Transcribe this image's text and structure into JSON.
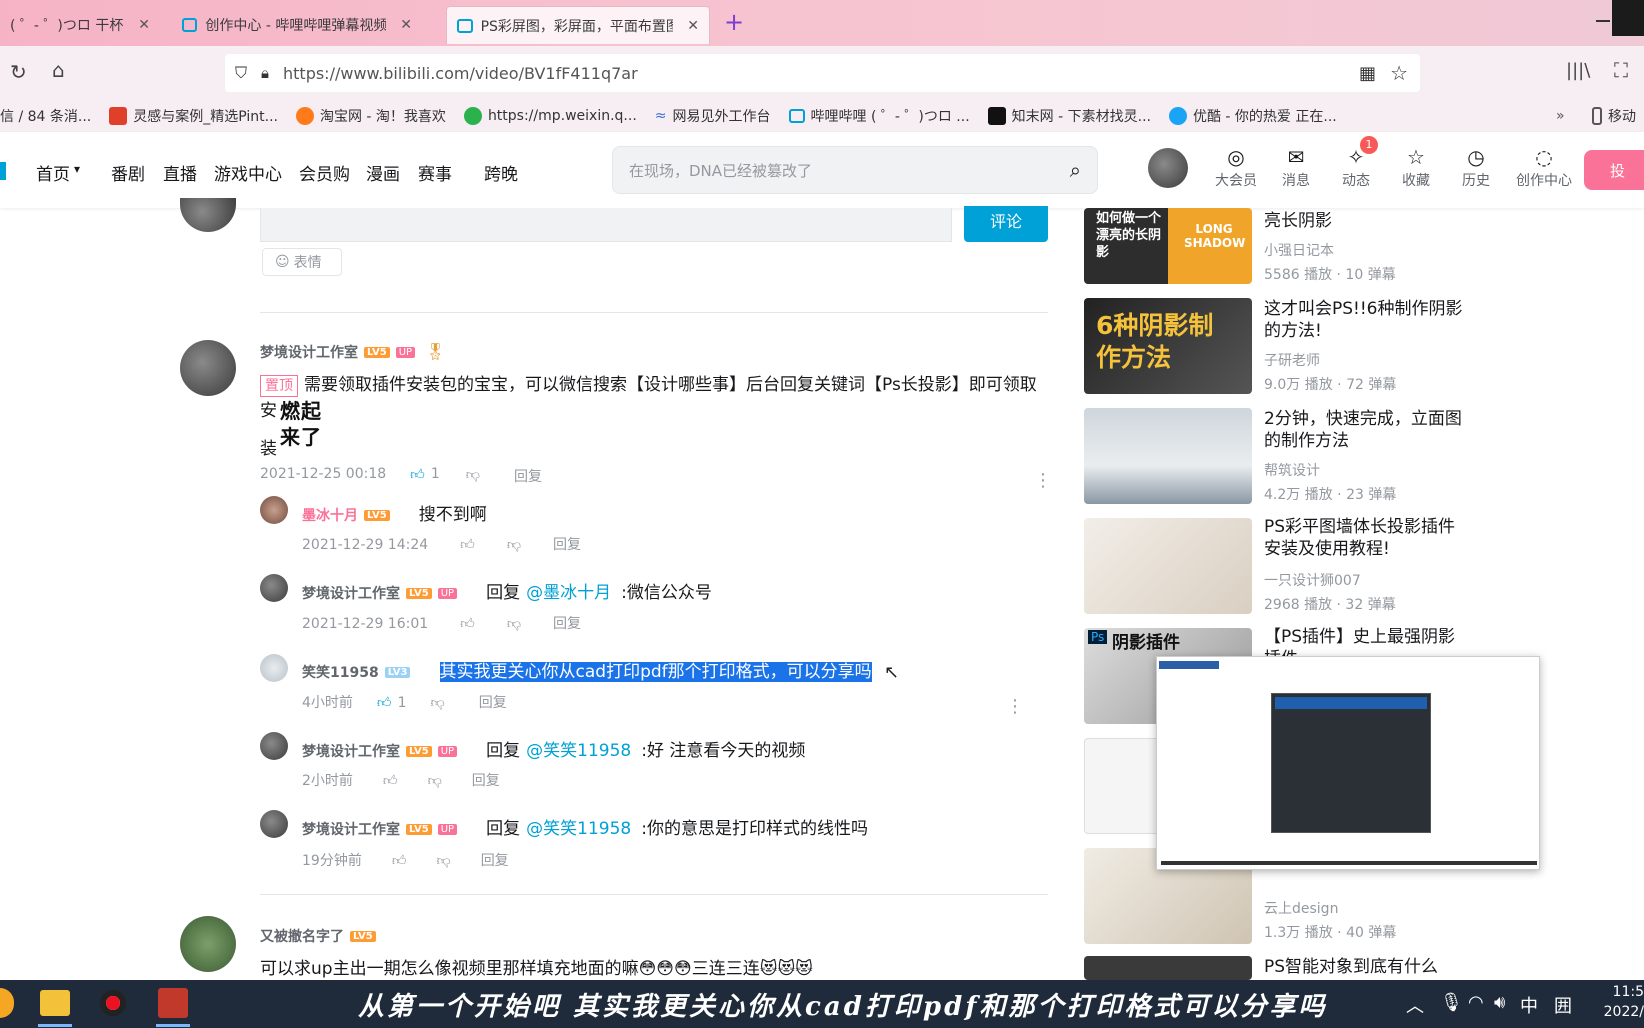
{
  "browser": {
    "tabs": [
      {
        "label": "( ゜- ゜)つロ 干杯~-bili"
      },
      {
        "label": "创作中心 - 哔哩哔哩弹幕视频网"
      },
      {
        "label": "PS彩屏图，彩屏面，平面布置图"
      }
    ],
    "new_tab": "+",
    "url": "https://www.bilibili.com/video/BV1fF411q7ar",
    "bookmarks": [
      {
        "label": "信 / 84 条消..."
      },
      {
        "label": "灵感与案例_精选Pint..."
      },
      {
        "label": "淘宝网 - 淘！我喜欢"
      },
      {
        "label": "https://mp.weixin.q..."
      },
      {
        "label": "网易见外工作台"
      },
      {
        "label": "哔哩哔哩 ( ゜- ゜)つロ ..."
      },
      {
        "label": "知末网 - 下素材找灵..."
      },
      {
        "label": "优酷 - 你的热爱 正在..."
      },
      {
        "label": "移动"
      }
    ]
  },
  "site": {
    "nav": [
      "首页",
      "番剧",
      "直播",
      "游戏中心",
      "会员购",
      "漫画",
      "赛事",
      "跨晚"
    ],
    "search_placeholder": "在现场，DNA已经被篡改了",
    "icons": [
      {
        "label": "大会员",
        "glyph": "◎"
      },
      {
        "label": "消息",
        "glyph": "✉"
      },
      {
        "label": "动态",
        "glyph": "✧",
        "badge": "1"
      },
      {
        "label": "收藏",
        "glyph": "☆"
      },
      {
        "label": "历史",
        "glyph": "◷"
      },
      {
        "label": "创作中心",
        "glyph": "◌"
      }
    ],
    "upload": "投"
  },
  "comments": {
    "submit_label": "评论",
    "emoji_label": "表情",
    "main": {
      "user": "梦境设计工作室",
      "level": "LV5",
      "up_badge": "UP",
      "pin": "置顶",
      "text": "需要领取插件安装包的宝宝，可以微信搜索【设计哪些事】后台回复关键词【Ps长投影】即可领取安",
      "text_tail": "装",
      "sticker": "燃起来了",
      "time": "2021-12-25 00:18",
      "likes": "1",
      "reply": "回复"
    },
    "replies": [
      {
        "user": "墨冰十月",
        "level": "LV5",
        "text": "搜不到啊",
        "time": "2021-12-29 14:24",
        "reply": "回复"
      },
      {
        "user": "梦境设计工作室",
        "level": "LV5",
        "up": "UP",
        "prefix": "回复",
        "mention": "@墨冰十月",
        "text": ":微信公众号",
        "time": "2021-12-29 16:01",
        "reply": "回复"
      },
      {
        "user": "笑笑11958",
        "level": "LV3",
        "text": "其实我更关心你从cad打印pdf那个打印格式，可以分享吗",
        "time": "4小时前",
        "likes": "1",
        "reply": "回复"
      },
      {
        "user": "梦境设计工作室",
        "level": "LV5",
        "up": "UP",
        "prefix": "回复",
        "mention": "@笑笑11958",
        "text": ":好 注意看今天的视频",
        "time": "2小时前",
        "reply": "回复"
      },
      {
        "user": "梦境设计工作室",
        "level": "LV5",
        "up": "UP",
        "prefix": "回复",
        "mention": "@笑笑11958",
        "text": ":你的意思是打印样式的线性吗",
        "time": "19分钟前",
        "reply": "回复"
      }
    ],
    "next": {
      "user": "又被撤名字了",
      "level": "LV5",
      "text": "可以求up主出一期怎么像视频里那样填充地面的嘛😳😳😳三连三连😻😻😻"
    }
  },
  "related": [
    {
      "title": "亮长阴影",
      "author": "小强日记本",
      "stats": "5586 播放 · 10 弹幕",
      "thumb_text": "如何做一个漂亮的长阴影",
      "thumb_tag": "LONG SHADOW"
    },
    {
      "title": "这才叫会PS!!6种制作阴影的方法!",
      "author": "子研老师",
      "stats": "9.0万 播放 · 72 弹幕",
      "thumb_text": "6种阴影制作方法"
    },
    {
      "title": "2分钟，快速完成，立面图的制作方法",
      "author": "帮筑设计",
      "stats": "4.2万 播放 · 23 弹幕"
    },
    {
      "title": "PS彩平图墙体长投影插件安装及使用教程!",
      "author": "一只设计狮007",
      "stats": "2968 播放 · 32 弹幕"
    },
    {
      "title": "【PS插件】史上最强阴影插件",
      "thumb_text": "阴影插件"
    },
    {
      "title": "",
      "author": "云上design",
      "stats": "1.3万 播放 · 40 弹幕"
    },
    {
      "title": "PS智能对象到底有什么"
    }
  ],
  "subtitle": "从第一个开始吧  其实我更关心你从cad打印pdf和那个打印格式可以分享吗",
  "taskbar": {
    "tray": "中",
    "time": "11:5",
    "date": "2022/"
  }
}
